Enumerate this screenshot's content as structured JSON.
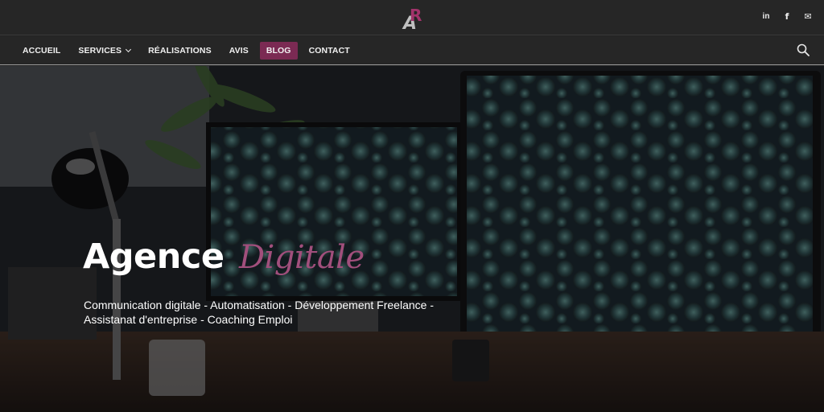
{
  "header": {
    "logo_name": "brand-logo",
    "social": [
      {
        "name": "linkedin-icon",
        "glyph": "in"
      },
      {
        "name": "facebook-icon",
        "glyph": "f"
      },
      {
        "name": "email-icon",
        "glyph": "✉"
      }
    ]
  },
  "nav": {
    "items": [
      {
        "label": "ACCUEIL"
      },
      {
        "label": "SERVICES"
      },
      {
        "label": "RÉALISATIONS"
      },
      {
        "label": "AVIS"
      },
      {
        "label": "BLOG"
      },
      {
        "label": "CONTACT"
      }
    ],
    "active": "BLOG"
  },
  "hero": {
    "title_main": "Agence",
    "title_accent": "Digitale",
    "subtitle_line1": "Communication digitale - Automatisation - Développement Freelance -",
    "subtitle_line2": "Assistanat d'entreprise - Coaching Emploi"
  },
  "colors": {
    "accent": "#7b2a53",
    "accent_text": "#a14f7c",
    "bar": "#262626"
  }
}
